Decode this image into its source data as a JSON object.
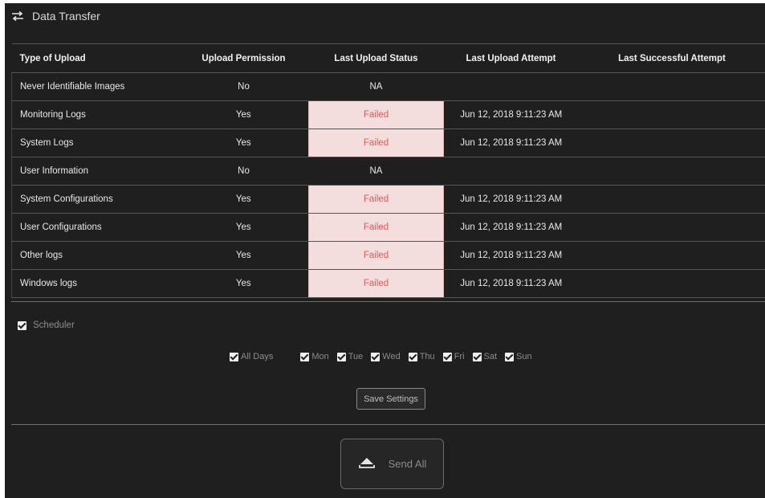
{
  "header": {
    "title": "Data Transfer",
    "icon": "transfer-arrows-icon"
  },
  "table": {
    "columns": [
      "Type of Upload",
      "Upload Permission",
      "Last Upload Status",
      "Last Upload Attempt",
      "Last Successful Attempt"
    ],
    "rows": [
      {
        "type": "Never Identifiable Images",
        "permission": "No",
        "status": "NA",
        "attempt": "",
        "success": ""
      },
      {
        "type": "Monitoring Logs",
        "permission": "Yes",
        "status": "Failed",
        "attempt": "Jun 12, 2018 9:11:23 AM",
        "success": ""
      },
      {
        "type": "System Logs",
        "permission": "Yes",
        "status": "Failed",
        "attempt": "Jun 12, 2018 9:11:23 AM",
        "success": ""
      },
      {
        "type": "User Information",
        "permission": "No",
        "status": "NA",
        "attempt": "",
        "success": ""
      },
      {
        "type": "System Configurations",
        "permission": "Yes",
        "status": "Failed",
        "attempt": "Jun 12, 2018 9:11:23 AM",
        "success": ""
      },
      {
        "type": "User Configurations",
        "permission": "Yes",
        "status": "Failed",
        "attempt": "Jun 12, 2018 9:11:23 AM",
        "success": ""
      },
      {
        "type": "Other logs",
        "permission": "Yes",
        "status": "Failed",
        "attempt": "Jun 12, 2018 9:11:23 AM",
        "success": ""
      },
      {
        "type": "Windows logs",
        "permission": "Yes",
        "status": "Failed",
        "attempt": "Jun 12, 2018 9:11:23 AM",
        "success": ""
      }
    ]
  },
  "scheduler": {
    "label": "Scheduler",
    "checked": true,
    "all_days": {
      "label": "All Days",
      "checked": true
    },
    "days": [
      {
        "label": "Mon",
        "checked": true
      },
      {
        "label": "Tue",
        "checked": true
      },
      {
        "label": "Wed",
        "checked": true
      },
      {
        "label": "Thu",
        "checked": true
      },
      {
        "label": "Fri",
        "checked": true
      },
      {
        "label": "Sat",
        "checked": true
      },
      {
        "label": "Sun",
        "checked": true
      }
    ],
    "save_label": "Save Settings"
  },
  "send": {
    "label": "Send All",
    "icon": "eject-upload-icon"
  },
  "colors": {
    "background": "#1f1f1f",
    "failed_bg": "#f4dddd",
    "failed_text": "#e05c5c",
    "text": "#e9e9e9",
    "muted": "#8c8c8c"
  }
}
